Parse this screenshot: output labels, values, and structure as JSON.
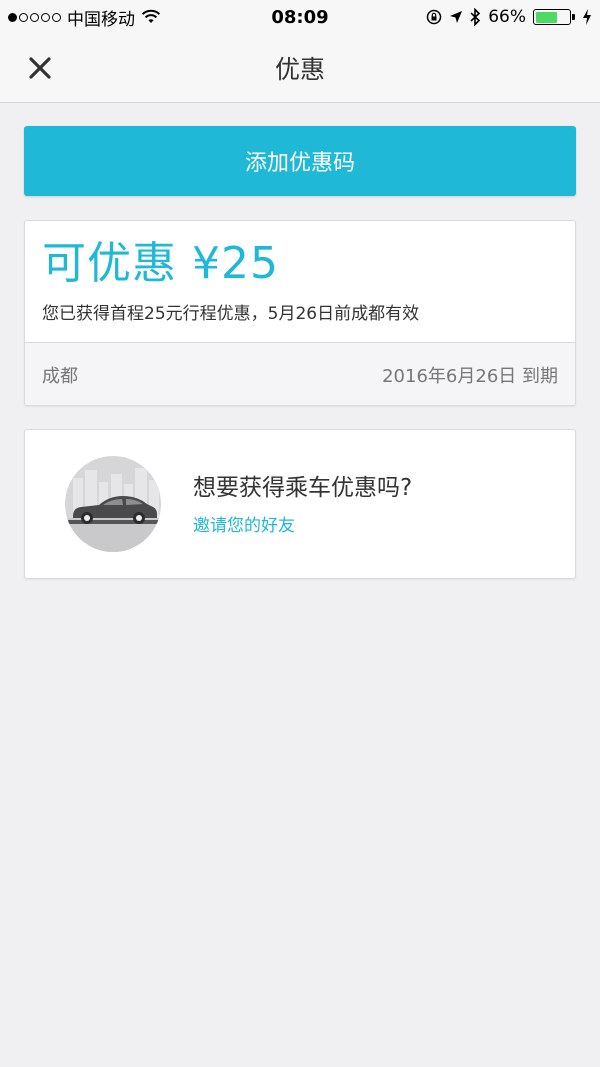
{
  "status_bar": {
    "carrier": "中国移动",
    "time": "08:09",
    "battery": "66%",
    "battery_level": 0.66,
    "signal_dots_filled": 1,
    "icons": [
      "signal-dots-icon",
      "wifi-icon",
      "orientation-lock-icon",
      "location-arrow-icon",
      "bluetooth-icon",
      "battery-icon",
      "charging-bolt-icon"
    ]
  },
  "nav": {
    "title": "优惠",
    "close_icon": "close-icon"
  },
  "add_promo_button": {
    "label": "添加优惠码"
  },
  "promo": {
    "amount": "可优惠 ¥25",
    "description": "您已获得首程25元行程优惠，5月26日前成都有效",
    "city": "成都",
    "expiry": "2016年6月26日 到期"
  },
  "invite": {
    "title": "想要获得乘车优惠吗?",
    "link": "邀请您的好友",
    "illustration_icon": "car-illustration-icon"
  },
  "colors": {
    "accent": "#1fb8d6",
    "background": "#f0f0f2",
    "battery_green": "#4cd964"
  }
}
